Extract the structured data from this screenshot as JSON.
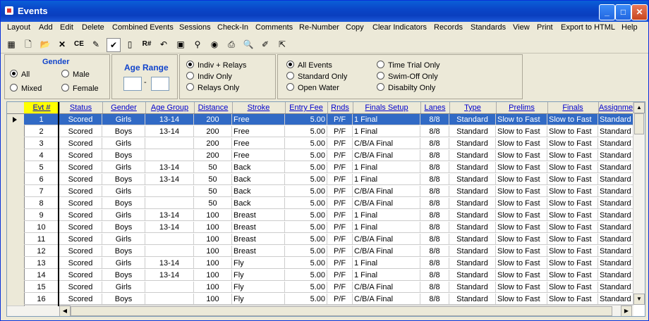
{
  "window": {
    "title": "Events"
  },
  "menu": [
    "Layout",
    "Add",
    "Edit",
    "Delete",
    "Combined Events",
    "Sessions",
    "Check-In",
    "Comments",
    "Re-Number",
    "Copy",
    "Clear Indicators",
    "Records",
    "Standards",
    "View",
    "Print",
    "Export to HTML",
    "Help"
  ],
  "toolbar": {
    "ce_label": "CE",
    "rnum_label": "R#"
  },
  "gender": {
    "title": "Gender",
    "options": [
      "All",
      "Male",
      "Mixed",
      "Female"
    ],
    "selected": "All"
  },
  "age_range": {
    "title": "Age Range",
    "dash": "-",
    "from": "",
    "to": ""
  },
  "event_kind": {
    "options": [
      "Indiv + Relays",
      "Indiv Only",
      "Relays Only"
    ],
    "selected": "Indiv + Relays"
  },
  "event_filter": {
    "options": [
      "All Events",
      "Standard Only",
      "Open Water",
      "Time Trial Only",
      "Swim-Off Only",
      "Disabilty Only"
    ],
    "selected": "All Events"
  },
  "table": {
    "columns": [
      "Evt #",
      "Status",
      "Gender",
      "Age Group",
      "Distance",
      "Stroke",
      "Entry Fee",
      "Rnds",
      "Finals Setup",
      "Lanes",
      "Type",
      "Prelims",
      "Finals",
      "Assignme"
    ],
    "selected_row": 0,
    "rows": [
      [
        "1",
        "Scored",
        "Girls",
        "13-14",
        "200",
        "Free",
        "5.00",
        "P/F",
        "1 Final",
        "8/8",
        "Standard",
        "Slow to Fast",
        "Slow to Fast",
        "Standard"
      ],
      [
        "2",
        "Scored",
        "Boys",
        "13-14",
        "200",
        "Free",
        "5.00",
        "P/F",
        "1 Final",
        "8/8",
        "Standard",
        "Slow to Fast",
        "Slow to Fast",
        "Standard"
      ],
      [
        "3",
        "Scored",
        "Girls",
        "",
        "200",
        "Free",
        "5.00",
        "P/F",
        "C/B/A Final",
        "8/8",
        "Standard",
        "Slow to Fast",
        "Slow to Fast",
        "Standard"
      ],
      [
        "4",
        "Scored",
        "Boys",
        "",
        "200",
        "Free",
        "5.00",
        "P/F",
        "C/B/A Final",
        "8/8",
        "Standard",
        "Slow to Fast",
        "Slow to Fast",
        "Standard"
      ],
      [
        "5",
        "Scored",
        "Girls",
        "13-14",
        "50",
        "Back",
        "5.00",
        "P/F",
        "1 Final",
        "8/8",
        "Standard",
        "Slow to Fast",
        "Slow to Fast",
        "Standard"
      ],
      [
        "6",
        "Scored",
        "Boys",
        "13-14",
        "50",
        "Back",
        "5.00",
        "P/F",
        "1 Final",
        "8/8",
        "Standard",
        "Slow to Fast",
        "Slow to Fast",
        "Standard"
      ],
      [
        "7",
        "Scored",
        "Girls",
        "",
        "50",
        "Back",
        "5.00",
        "P/F",
        "C/B/A Final",
        "8/8",
        "Standard",
        "Slow to Fast",
        "Slow to Fast",
        "Standard"
      ],
      [
        "8",
        "Scored",
        "Boys",
        "",
        "50",
        "Back",
        "5.00",
        "P/F",
        "C/B/A Final",
        "8/8",
        "Standard",
        "Slow to Fast",
        "Slow to Fast",
        "Standard"
      ],
      [
        "9",
        "Scored",
        "Girls",
        "13-14",
        "100",
        "Breast",
        "5.00",
        "P/F",
        "1 Final",
        "8/8",
        "Standard",
        "Slow to Fast",
        "Slow to Fast",
        "Standard"
      ],
      [
        "10",
        "Scored",
        "Boys",
        "13-14",
        "100",
        "Breast",
        "5.00",
        "P/F",
        "1 Final",
        "8/8",
        "Standard",
        "Slow to Fast",
        "Slow to Fast",
        "Standard"
      ],
      [
        "11",
        "Scored",
        "Girls",
        "",
        "100",
        "Breast",
        "5.00",
        "P/F",
        "C/B/A Final",
        "8/8",
        "Standard",
        "Slow to Fast",
        "Slow to Fast",
        "Standard"
      ],
      [
        "12",
        "Scored",
        "Boys",
        "",
        "100",
        "Breast",
        "5.00",
        "P/F",
        "C/B/A Final",
        "8/8",
        "Standard",
        "Slow to Fast",
        "Slow to Fast",
        "Standard"
      ],
      [
        "13",
        "Scored",
        "Girls",
        "13-14",
        "100",
        "Fly",
        "5.00",
        "P/F",
        "1 Final",
        "8/8",
        "Standard",
        "Slow to Fast",
        "Slow to Fast",
        "Standard"
      ],
      [
        "14",
        "Scored",
        "Boys",
        "13-14",
        "100",
        "Fly",
        "5.00",
        "P/F",
        "1 Final",
        "8/8",
        "Standard",
        "Slow to Fast",
        "Slow to Fast",
        "Standard"
      ],
      [
        "15",
        "Scored",
        "Girls",
        "",
        "100",
        "Fly",
        "5.00",
        "P/F",
        "C/B/A Final",
        "8/8",
        "Standard",
        "Slow to Fast",
        "Slow to Fast",
        "Standard"
      ],
      [
        "16",
        "Scored",
        "Boys",
        "",
        "100",
        "Fly",
        "5.00",
        "P/F",
        "C/B/A Final",
        "8/8",
        "Standard",
        "Slow to Fast",
        "Slow to Fast",
        "Standard"
      ]
    ]
  }
}
